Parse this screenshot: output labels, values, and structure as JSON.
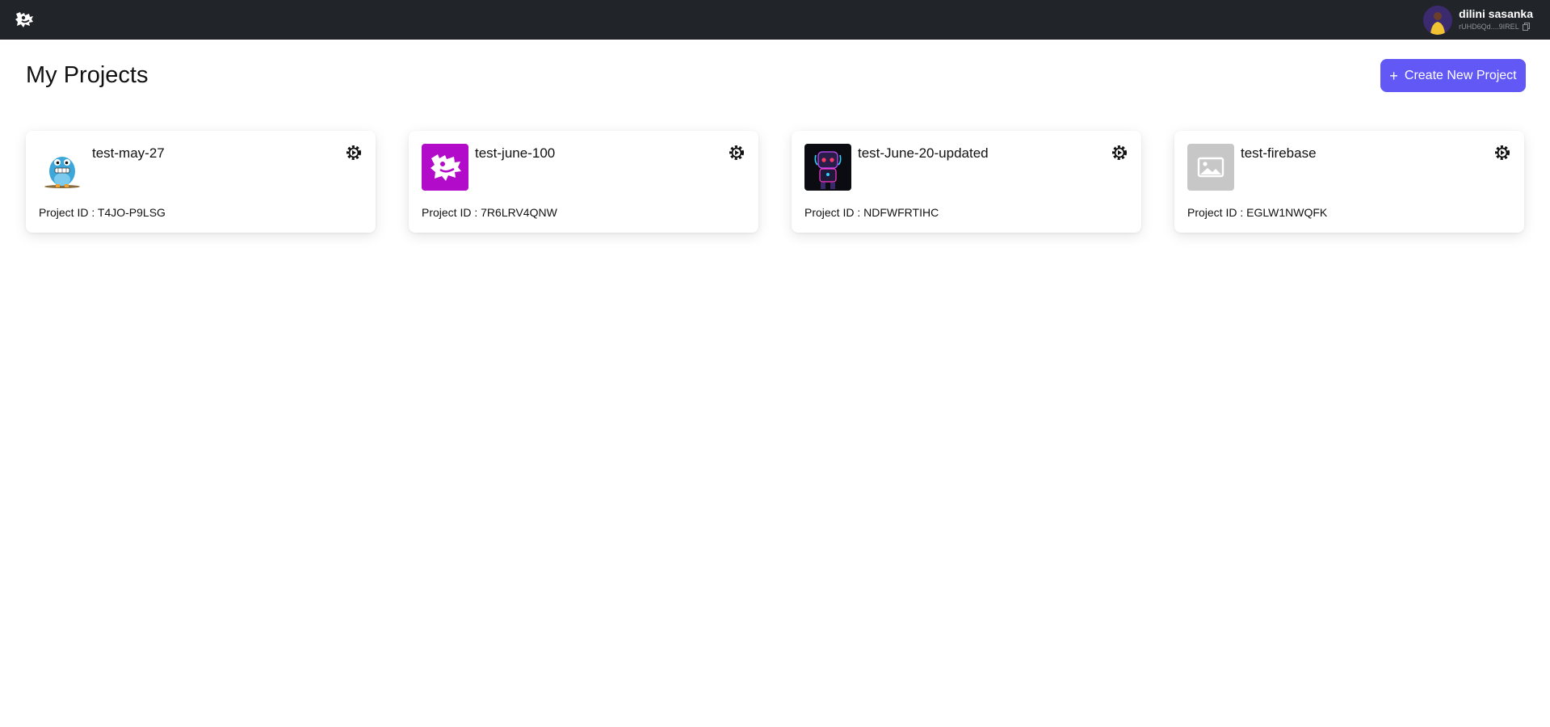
{
  "header": {
    "logo_icon": "dragon-logo-icon",
    "user": {
      "name": "dilini sasanka",
      "id_short": "rUHD6Qd....9IREL",
      "copy_icon": "copy-icon"
    }
  },
  "main": {
    "title": "My Projects",
    "create_button": {
      "label": "Create New Project",
      "icon": "plus-icon"
    },
    "projects": [
      {
        "name": "test-may-27",
        "id_label": "Project ID :",
        "id": "T4JO-P9LSG",
        "thumb": "blue-monster"
      },
      {
        "name": "test-june-100",
        "id_label": "Project ID :",
        "id": "7R6LRV4QNW",
        "thumb": "purple-dragon"
      },
      {
        "name": "test-June-20-updated",
        "id_label": "Project ID :",
        "id": "NDFWFRTIHC",
        "thumb": "neon-robot"
      },
      {
        "name": "test-firebase",
        "id_label": "Project ID :",
        "id": "EGLW1NWQFK",
        "thumb": "placeholder-image"
      }
    ]
  },
  "colors": {
    "topbar": "#212529",
    "accent": "#6158f5",
    "purple_thumb": "#b20bc9"
  }
}
